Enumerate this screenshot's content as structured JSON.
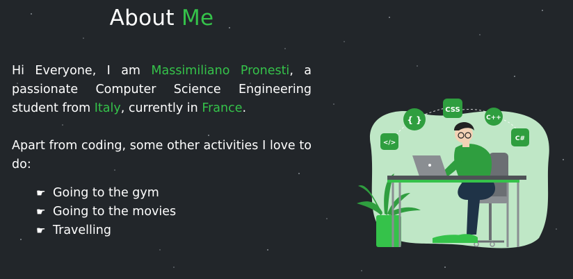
{
  "heading": {
    "prefix": "About",
    "accent": "Me"
  },
  "intro": {
    "part1": "Hi Everyone, I am",
    "name": "Massimiliano Pronesti",
    "part2": ", a passionate Computer Science Engineering student from",
    "country_from": "Italy",
    "part3": ", currently in",
    "country_now": "France",
    "part4": "."
  },
  "hobbies_intro": "Apart from coding, some other activities I love to do:",
  "hobbies": [
    {
      "icon": "pointing-hand-icon",
      "label": "Going to the gym"
    },
    {
      "icon": "pointing-hand-icon",
      "label": "Going to the movies"
    },
    {
      "icon": "pointing-hand-icon",
      "label": "Travelling"
    }
  ],
  "illustration": {
    "badges": [
      "{ }",
      "CSS",
      "C++",
      "</>",
      "C#"
    ]
  },
  "colors": {
    "background": "#22262a",
    "accent": "#35c24a",
    "text": "#ffffff"
  }
}
